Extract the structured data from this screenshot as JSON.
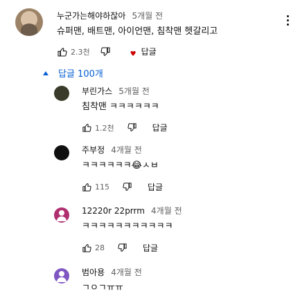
{
  "comment": {
    "author": "누군가는해야하잖아",
    "time": "5개월 전",
    "text": "슈퍼맨, 배트맨, 아이언맨, 침착맨 헷갈리고",
    "likes": "2.3천",
    "reply_label": "답글",
    "replies_toggle": "답글 100개"
  },
  "replies": [
    {
      "author": "부린가스",
      "time": "5개월 전",
      "text": "침착맨 ㅋㅋㅋㅋㅋㅋ",
      "likes": "1.2천",
      "reply_label": "답글",
      "avatar_color": "#3b3b2b"
    },
    {
      "author": "주부정",
      "time": "4개월 전",
      "text": "ㅋㅋㅋㅋㅋㅋ😂ㅅㅂ",
      "likes": "115",
      "reply_label": "답글",
      "avatar_color": "#0f0f0f"
    },
    {
      "author": "12220r 22prrm",
      "time": "4개월 전",
      "text": "ㅋㅋㅋㅋㅋㅋㅋㅋㅋㅋㅋ",
      "likes": "28",
      "reply_label": "답글",
      "avatar_color": "#b0306f"
    },
    {
      "author": "범아용",
      "time": "4개월 전",
      "text": "ㄱㅇㄱㅠㅠ",
      "likes": "",
      "reply_label": "",
      "avatar_color": "#7e57c2"
    }
  ],
  "colors": {
    "link_blue": "#065fd4",
    "heart_red": "#cc0000"
  },
  "icons": [
    "thumb-up-icon",
    "thumb-down-icon",
    "heart-icon",
    "kebab-menu-icon",
    "chevron-up-icon"
  ]
}
